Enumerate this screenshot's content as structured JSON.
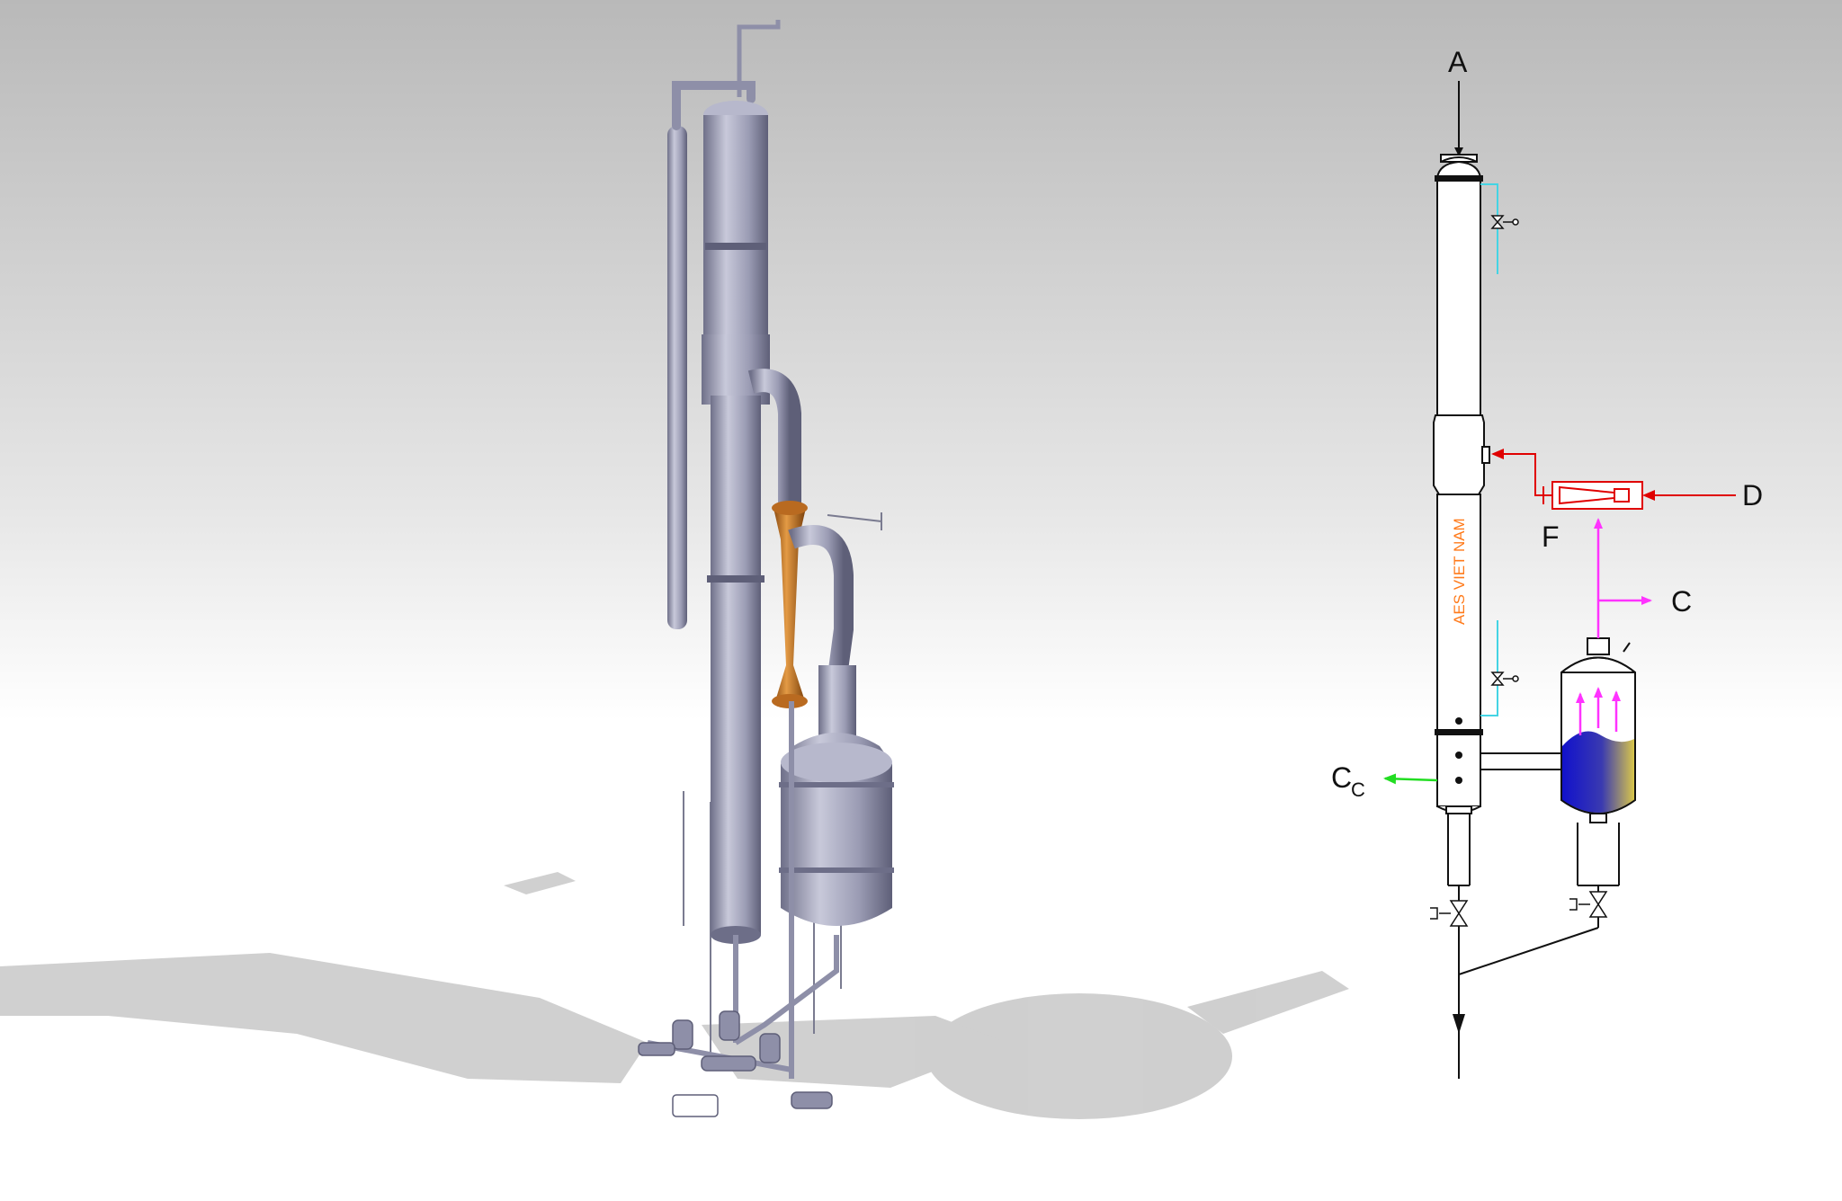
{
  "colors": {
    "background_top": "#b9b9b9",
    "background_bottom": "#ffffff",
    "vessel": "#a2a3bb",
    "vessel_dark": "#6d6e88",
    "venturi": "#c77a22",
    "motive_line": "#e00000",
    "vapor_line": "#ff33ff",
    "cooling_line": "#44d4e4",
    "condensate_line": "#22dd22",
    "liquid": "#1111cc",
    "liquid_light": "#d8c64a",
    "watermark": "#ff7a1a"
  },
  "schematic": {
    "labels": {
      "a": "A",
      "c": "C",
      "d": "D",
      "f": "F",
      "cc_main": "C",
      "cc_sub": "C"
    },
    "watermark": "AES VIET NAM"
  }
}
